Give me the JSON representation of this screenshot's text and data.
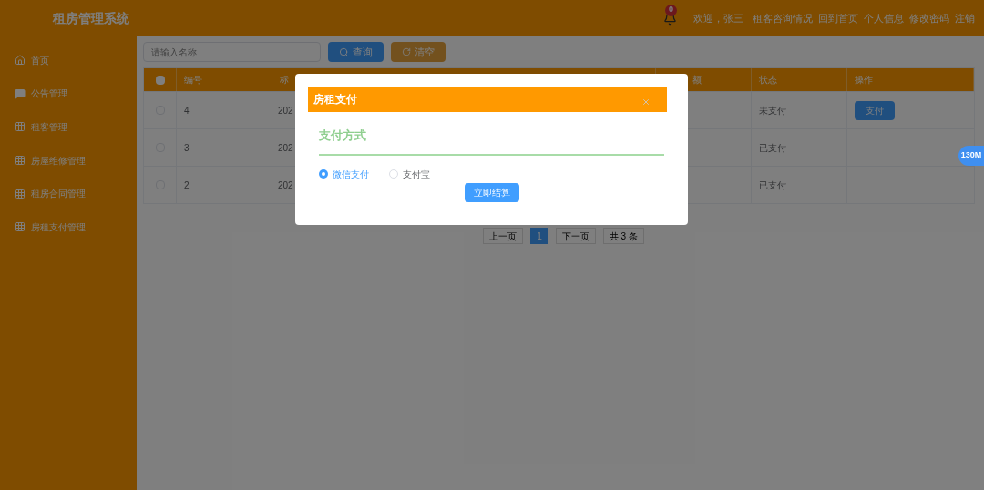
{
  "header": {
    "title": "租房管理系统",
    "notification_count": "0",
    "links": [
      "欢迎，张三",
      "租客咨询情况",
      "回到首页",
      "个人信息",
      "修改密码",
      "注销"
    ]
  },
  "sidebar": {
    "items": [
      {
        "label": "首页",
        "kind": "home"
      },
      {
        "label": "公告管理",
        "kind": "message"
      },
      {
        "label": "租客管理",
        "kind": "grid"
      },
      {
        "label": "房屋维修管理",
        "kind": "grid"
      },
      {
        "label": "租房合同管理",
        "kind": "grid"
      },
      {
        "label": "房租支付管理",
        "kind": "grid"
      }
    ]
  },
  "toolbar": {
    "search": {
      "placeholder": "请输入名称"
    },
    "buttons": [
      {
        "label": "查询",
        "kind": "search"
      },
      {
        "label": "清空",
        "kind": "reset"
      }
    ]
  },
  "table": {
    "select_all_checked": false,
    "columns": [
      "编号",
      "标",
      "额",
      "状态",
      "操作"
    ],
    "rows": [
      {
        "checked": false,
        "id": "4",
        "title": "202",
        "status": "未支付",
        "action": "支付"
      },
      {
        "checked": false,
        "id": "3",
        "title": "202",
        "status": "已支付"
      },
      {
        "checked": false,
        "id": "2",
        "title": "202",
        "status": "已支付"
      }
    ]
  },
  "pagination": {
    "prev": "上一页",
    "pages": [
      {
        "label": "1",
        "selected": true
      }
    ],
    "next": "下一页",
    "total": "共 3 条"
  },
  "memory_badge": "130M",
  "dialog": {
    "title": "房租支付",
    "section": "支付方式",
    "options": [
      {
        "label": "微信支付",
        "selected": true
      },
      {
        "label": "支付宝",
        "selected": false
      }
    ],
    "submit": "立即结算"
  }
}
